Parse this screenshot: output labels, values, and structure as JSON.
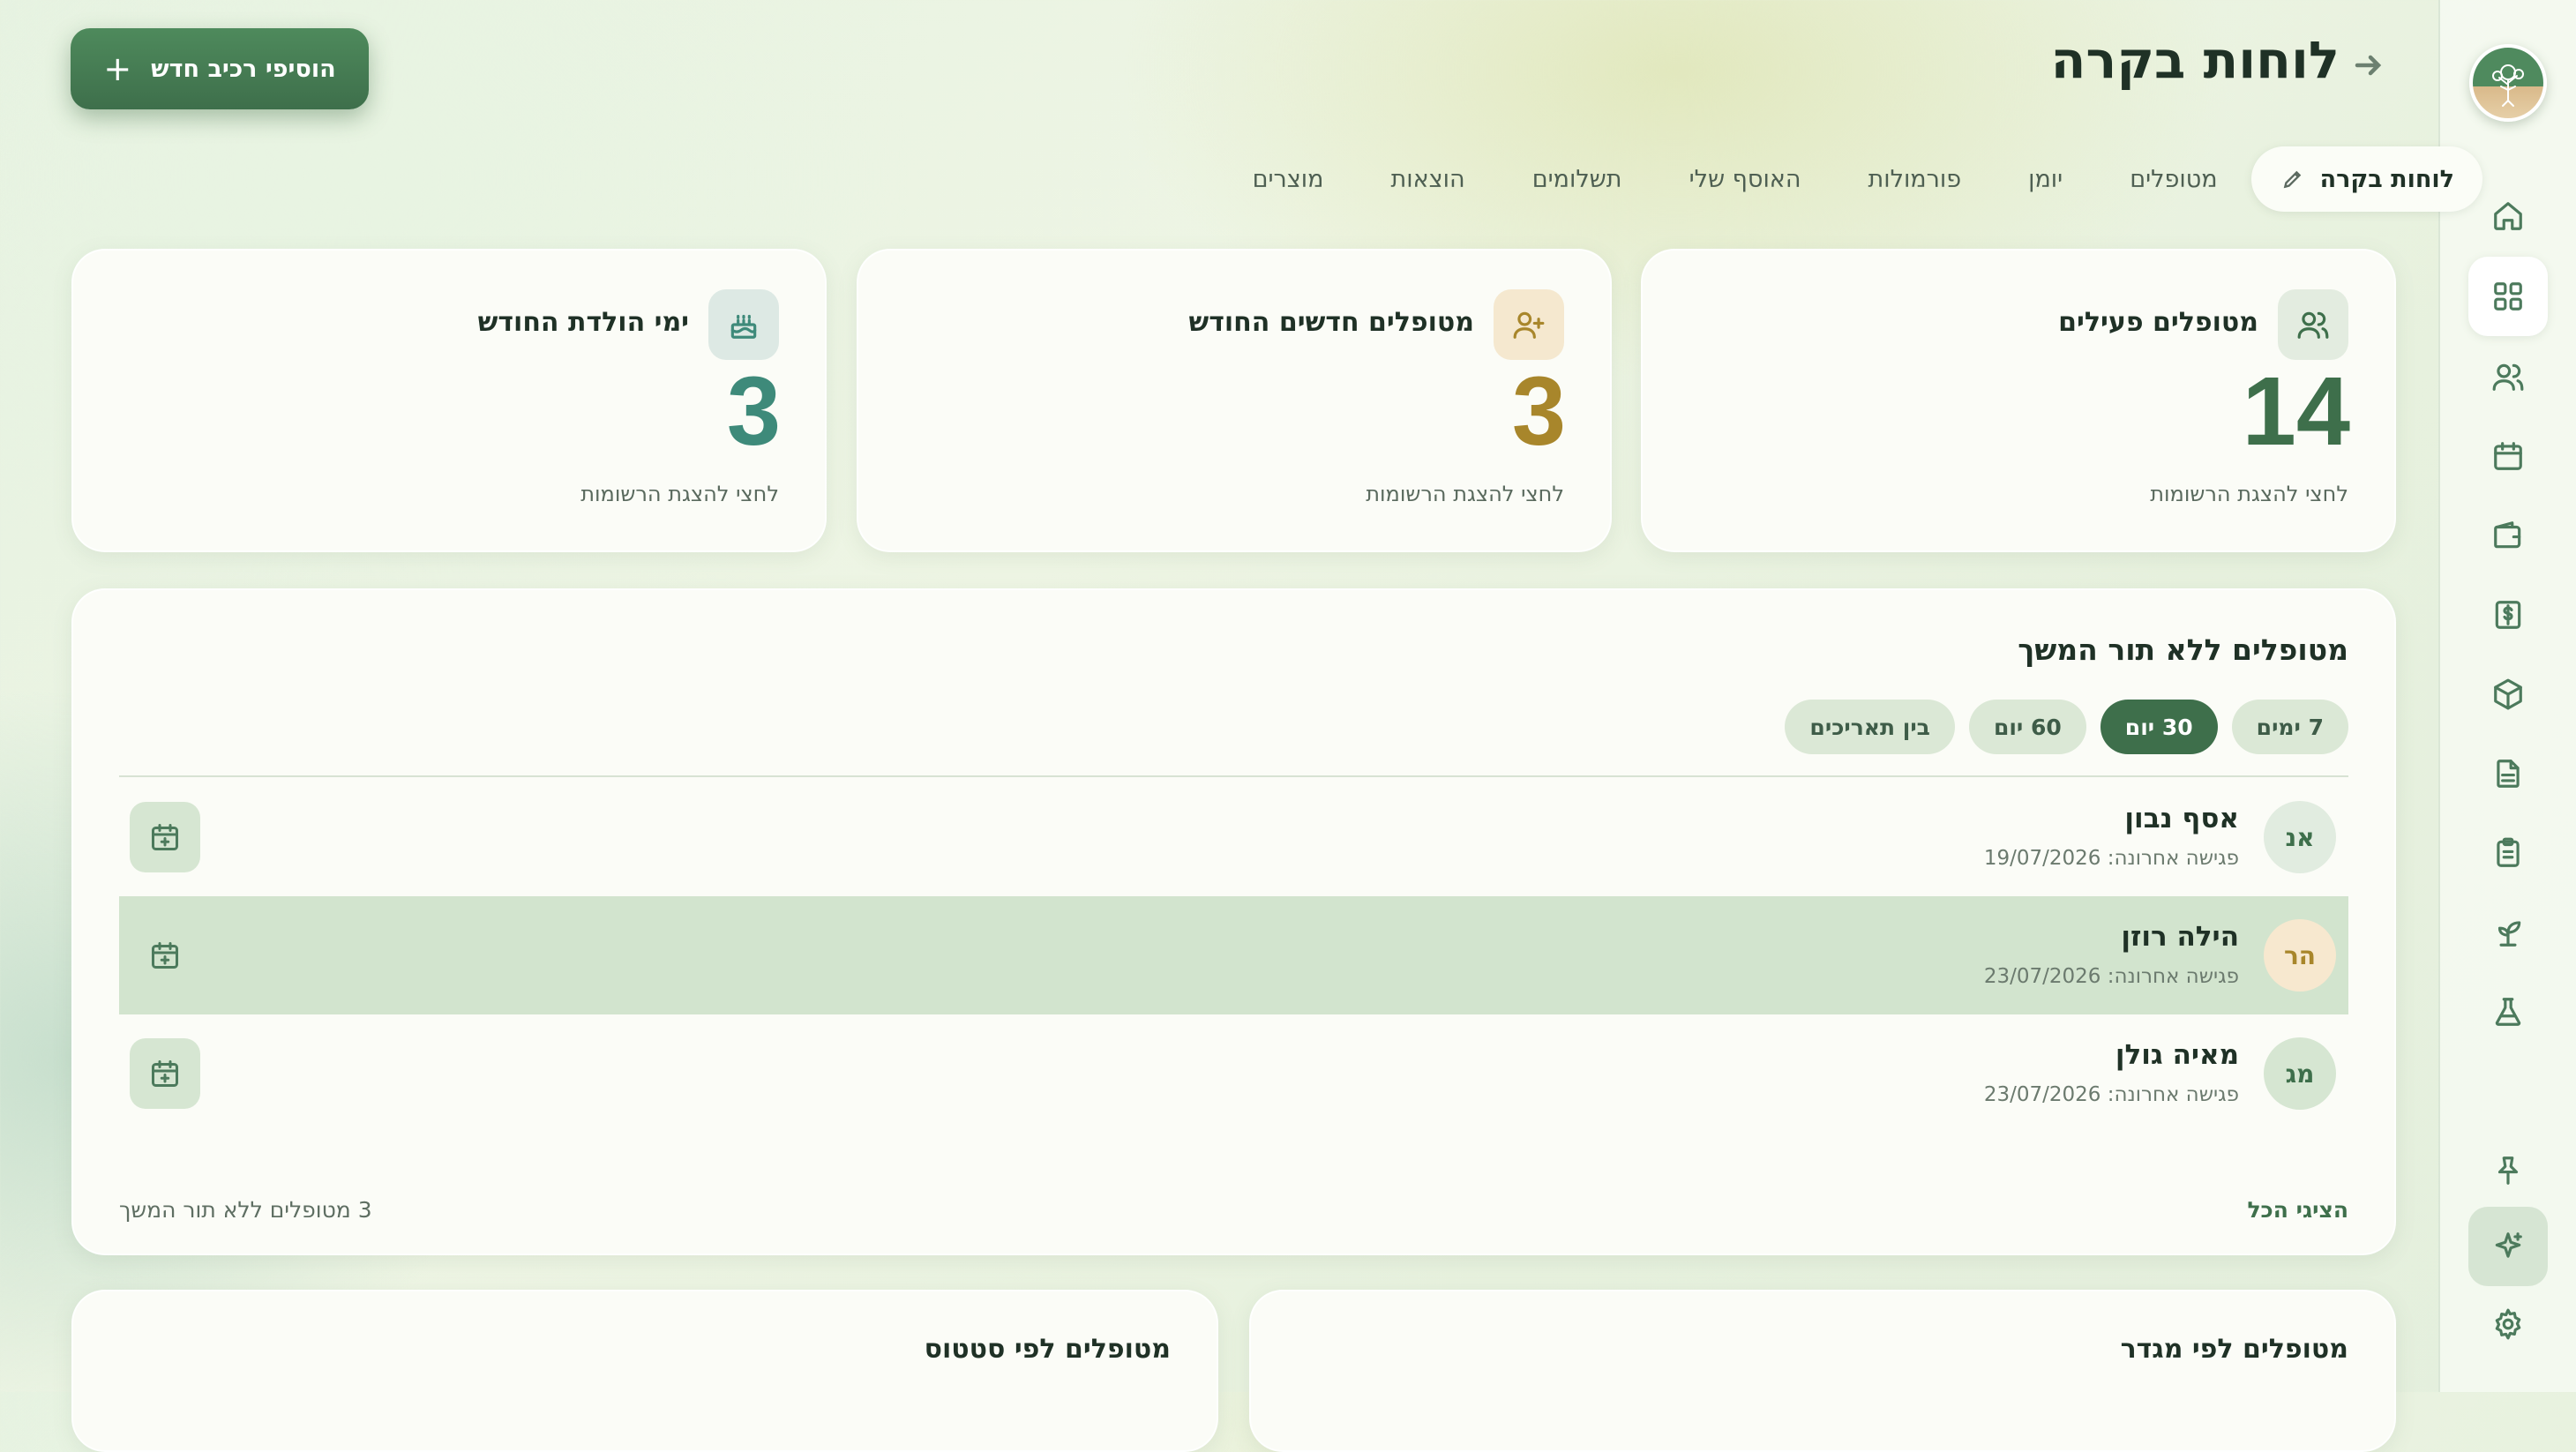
{
  "header": {
    "title": "לוחות בקרה",
    "add_button_label": "הוסיפי רכיב חדש"
  },
  "tabs": [
    {
      "label": "לוחות בקרה",
      "active": true
    },
    {
      "label": "מטופלים"
    },
    {
      "label": "יומן"
    },
    {
      "label": "פורמולות"
    },
    {
      "label": "האוסף שלי"
    },
    {
      "label": "תשלומים"
    },
    {
      "label": "הוצאות"
    },
    {
      "label": "מוצרים"
    }
  ],
  "stats": [
    {
      "title": "מטופלים פעילים",
      "value": "14",
      "hint": "לחצי להצגת הרשומות",
      "icon": "users-icon",
      "color": "#3e6f4b",
      "icon_bg": "#e3ece0"
    },
    {
      "title": "מטופלים חדשים החודש",
      "value": "3",
      "hint": "לחצי להצגת הרשומות",
      "icon": "user-plus-icon",
      "color": "#a8862b",
      "icon_bg": "#f5e8cf"
    },
    {
      "title": "ימי הולדת החודש",
      "value": "3",
      "hint": "לחצי להצגת הרשומות",
      "icon": "cake-icon",
      "color": "#3e8a7a",
      "icon_bg": "#dde9e4"
    }
  ],
  "followup": {
    "title": "מטופלים ללא תור המשך",
    "filters": [
      {
        "label": "7 ימים",
        "active": false
      },
      {
        "label": "30 יום",
        "active": true
      },
      {
        "label": "60 יום",
        "active": false
      },
      {
        "label": "בין תאריכים",
        "active": false
      }
    ],
    "patients": [
      {
        "initials": "אנ",
        "name": "אסף נבון",
        "last_visit": "פגישה אחרונה: 19/07/2026",
        "avatar_bg": "#e1ece0",
        "avatar_color": "#3e6f4b",
        "highlighted": false
      },
      {
        "initials": "הר",
        "name": "הילה רוזן",
        "last_visit": "פגישה אחרונה: 23/07/2026",
        "avatar_bg": "#f7e8cf",
        "avatar_color": "#a8862b",
        "highlighted": true
      },
      {
        "initials": "מג",
        "name": "מאיה גולן",
        "last_visit": "פגישה אחרונה: 23/07/2026",
        "avatar_bg": "#d6e6d2",
        "avatar_color": "#3e6f4b",
        "highlighted": false
      }
    ],
    "show_all": "הציגי הכל",
    "count_text": "3 מטופלים ללא תור המשך"
  },
  "bottom_cards": {
    "gender_title": "מטופלים לפי מגדר",
    "status_title": "מטופלים לפי סטטוס"
  },
  "sidebar": {
    "items": [
      "home-icon",
      "dashboard-icon",
      "users-icon",
      "calendar-icon",
      "wallet-icon",
      "dollar-icon",
      "package-icon",
      "document-icon",
      "clipboard-icon",
      "sprout-icon",
      "flask-icon",
      "pin-icon",
      "sparkles-icon",
      "gear-icon"
    ],
    "active": "dashboard-icon"
  }
}
